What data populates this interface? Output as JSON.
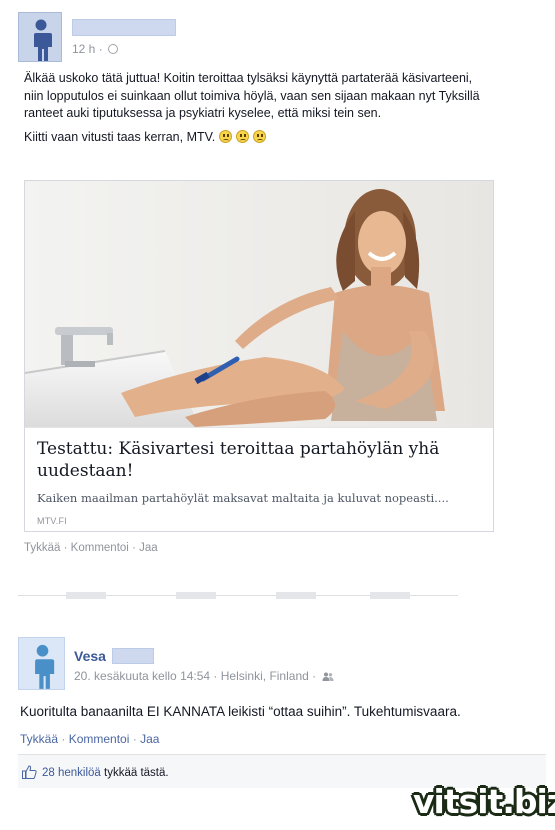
{
  "post": {
    "time": "12 h ·",
    "paragraph1": "Älkää uskoko tätä juttua! Koitin teroittaa tylsäksi käynyttä partaterää käsivarteeni, niin lopputulos ei suinkaan ollut toimiva höylä, vaan sen sijaan makaan nyt Tyksillä ranteet auki tiputuksessa ja psykiatri kyselee, että miksi tein sen.",
    "paragraph2": "Kiitti vaan vitusti taas kerran, MTV.",
    "link": {
      "title": "Testattu: Käsivartesi teroittaa partahöylän yhä uudestaan!",
      "description": "Kaiken maailman partahöylät maksavat maltaita ja kuluvat nopeasti....",
      "source": "MTV.FI"
    },
    "actions": {
      "like": "Tykkää",
      "comment": "Kommentoi",
      "share": "Jaa",
      "separator": " · "
    }
  },
  "comment": {
    "name": "Vesa",
    "meta": "20. kesäkuuta kello 14:54 · Helsinki, Finland ·",
    "text": "Kuoritulta banaanilta EI KANNATA leikisti “ottaa suihin”. Tukehtumisvaara.",
    "actions": {
      "like": "Tykkää",
      "comment": "Kommentoi",
      "share": "Jaa",
      "separator": " · "
    },
    "likes": {
      "count_text": "28 henkilöä",
      "suffix": " tykkää tästä."
    }
  },
  "watermark": "vitsit.biz",
  "icons": {
    "avatar": "default-person-icon",
    "privacy": "globe-icon",
    "emoji": "frowning-face-icon",
    "audience": "friends-icon",
    "like": "thumbs-up-icon"
  },
  "colors": {
    "link_blue": "#3b5998",
    "muted_gray": "#90949c",
    "avatar_bg": "#c7d4ea"
  }
}
